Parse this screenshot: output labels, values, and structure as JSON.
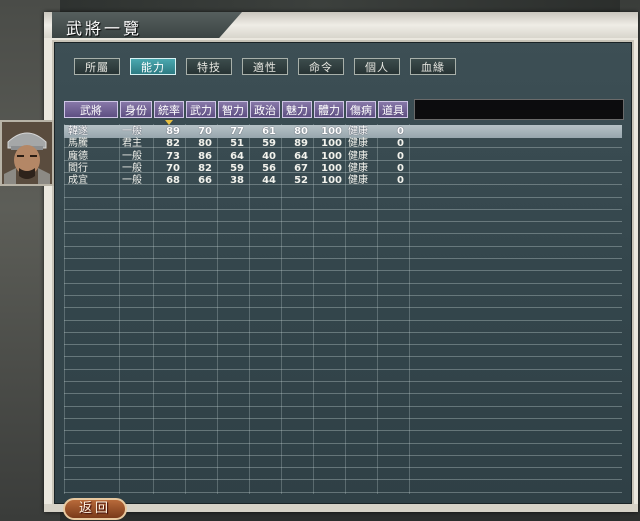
{
  "window": {
    "title": "武將一覽"
  },
  "tabs": [
    {
      "label": "所屬",
      "active": false
    },
    {
      "label": "能力",
      "active": true
    },
    {
      "label": "特技",
      "active": false
    },
    {
      "label": "適性",
      "active": false
    },
    {
      "label": "命令",
      "active": false
    },
    {
      "label": "個人",
      "active": false
    },
    {
      "label": "血緣",
      "active": false
    }
  ],
  "table": {
    "headers": [
      "武將",
      "身份",
      "統率",
      "武力",
      "智力",
      "政治",
      "魅力",
      "體力",
      "傷病",
      "道具"
    ],
    "sorted_column": "統率",
    "rows": [
      {
        "name": "韓遂",
        "rank": "一般",
        "lead": "89",
        "war": "70",
        "int": "77",
        "pol": "61",
        "chr": "80",
        "hp": "100",
        "status": "健康",
        "items": "0",
        "selected": true
      },
      {
        "name": "馬騰",
        "rank": "君主",
        "lead": "82",
        "war": "80",
        "int": "51",
        "pol": "59",
        "chr": "89",
        "hp": "100",
        "status": "健康",
        "items": "0",
        "selected": false
      },
      {
        "name": "龐德",
        "rank": "一般",
        "lead": "73",
        "war": "86",
        "int": "64",
        "pol": "40",
        "chr": "64",
        "hp": "100",
        "status": "健康",
        "items": "0",
        "selected": false
      },
      {
        "name": "閻行",
        "rank": "一般",
        "lead": "70",
        "war": "82",
        "int": "59",
        "pol": "56",
        "chr": "67",
        "hp": "100",
        "status": "健康",
        "items": "0",
        "selected": false
      },
      {
        "name": "成宜",
        "rank": "一般",
        "lead": "68",
        "war": "66",
        "int": "38",
        "pol": "44",
        "chr": "52",
        "hp": "100",
        "status": "健康",
        "items": "0",
        "selected": false
      }
    ]
  },
  "footer": {
    "back_label": "返回"
  },
  "colors": {
    "active_tab": "#2d7a82",
    "header_cell": "#5e4f82",
    "panel_bg": "#34464c",
    "selected_row": "#97a6ad"
  }
}
